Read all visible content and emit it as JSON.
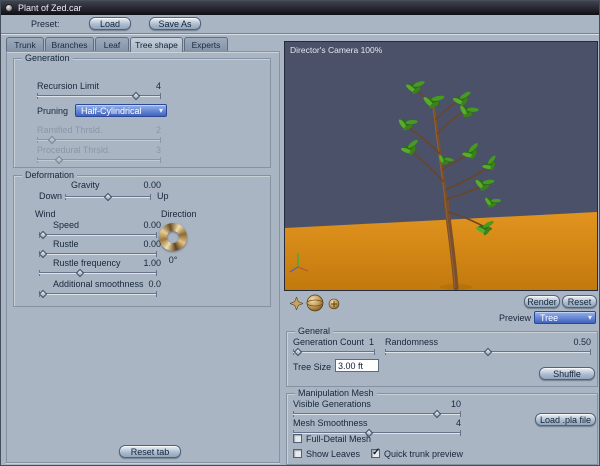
{
  "window": {
    "title": "Plant of Zed.car"
  },
  "preset": {
    "label": "Preset:",
    "load": "Load",
    "save_as": "Save As"
  },
  "tabs": [
    {
      "label": "Trunk"
    },
    {
      "label": "Branches"
    },
    {
      "label": "Leaf"
    },
    {
      "label": "Tree shape"
    },
    {
      "label": "Experts"
    }
  ],
  "generation": {
    "title": "Generation",
    "recursion_limit": {
      "label": "Recursion Limit",
      "value": "4"
    },
    "pruning": {
      "label": "Pruning",
      "value": "Half-Cylindrical"
    },
    "ramified": {
      "label": "Ramified Thrsld.",
      "value": "2"
    },
    "procedural": {
      "label": "Procedural Thrsld.",
      "value": "3"
    }
  },
  "deformation": {
    "title": "Deformation",
    "gravity": {
      "label": "Gravity",
      "value": "0.00",
      "down": "Down",
      "up": "Up"
    },
    "wind_label": "Wind",
    "speed": {
      "label": "Speed",
      "value": "0.00"
    },
    "rustle": {
      "label": "Rustle",
      "value": "0.00"
    },
    "rustle_frequency": {
      "label": "Rustle frequency",
      "value": "1.00"
    },
    "direction": {
      "label": "Direction",
      "value": "0°"
    },
    "additional_smoothness": {
      "label": "Additional smoothness",
      "value": "0.0"
    }
  },
  "reset_tab": "Reset tab",
  "viewport": {
    "camera_label": "Director's Camera 100%"
  },
  "viewport_controls": {
    "render": "Render",
    "reset": "Reset",
    "preview_label": "Preview",
    "preview_value": "Tree"
  },
  "general": {
    "title": "General",
    "generation_count": {
      "label": "Generation Count",
      "value": "1"
    },
    "randomness": {
      "label": "Randomness",
      "value": "0.50"
    },
    "tree_size": {
      "label": "Tree Size",
      "value": "3.00 ft"
    },
    "shuffle": "Shuffle"
  },
  "manipulation": {
    "title": "Manipulation Mesh",
    "visible_generations": {
      "label": "Visible Generations",
      "value": "10"
    },
    "mesh_smoothness": {
      "label": "Mesh Smoothness",
      "value": "4"
    },
    "load_pla": "Load .pla file",
    "full_detail": {
      "label": "Full-Detail Mesh",
      "checked": false
    },
    "show_leaves": {
      "label": "Show Leaves",
      "checked": false
    },
    "quick_trunk": {
      "label": "Quick trunk preview",
      "checked": true
    }
  },
  "colors": {
    "accent_blue": "#4162bd",
    "sky": "#4a5168",
    "ground": "#d8891a",
    "foliage": "#459a20",
    "trunk": "#7b4f2a",
    "bronze": "#c49a56"
  }
}
